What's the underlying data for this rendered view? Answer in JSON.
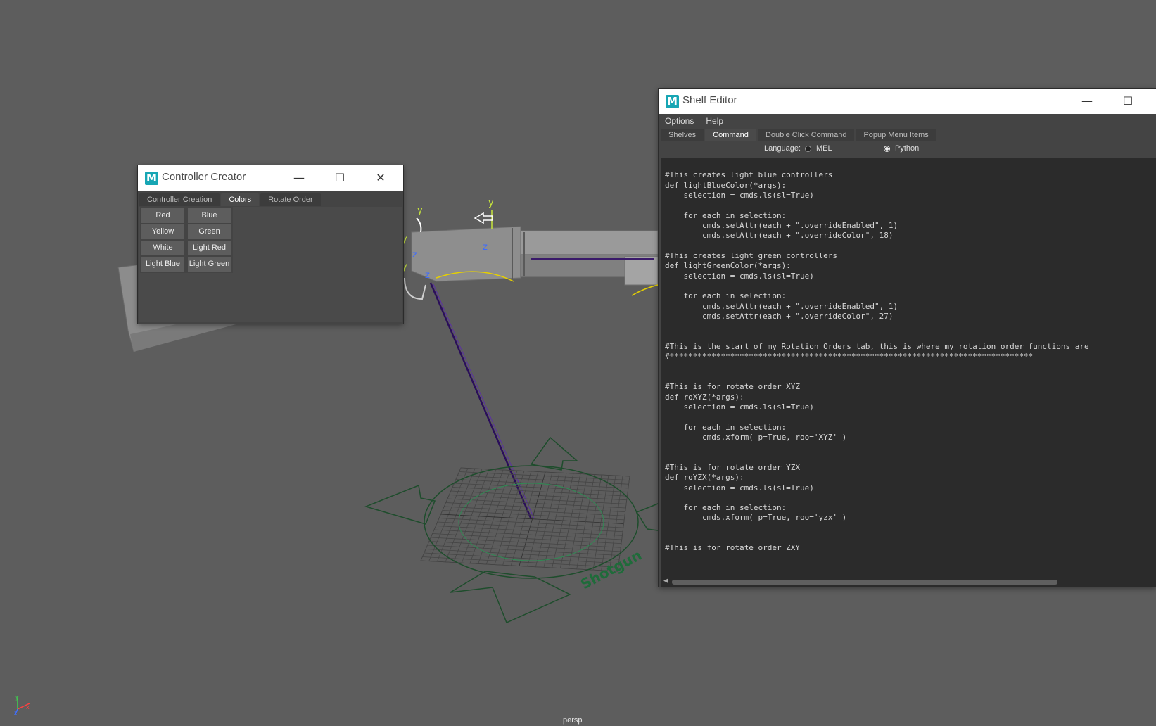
{
  "viewport": {
    "camera_label": "persp",
    "controller_text": "Shotgun",
    "axis_labels": {
      "y": "y",
      "z": "z",
      "x": "x"
    }
  },
  "controller_creator": {
    "title": "Controller Creator",
    "window_buttons": {
      "minimize": "—",
      "maximize": "☐",
      "close": "✕"
    },
    "tabs": [
      {
        "label": "Controller Creation",
        "active": false
      },
      {
        "label": "Colors",
        "active": true
      },
      {
        "label": "Rotate Order",
        "active": false
      }
    ],
    "color_buttons": [
      "Red",
      "Blue",
      "Yellow",
      "Green",
      "White",
      "Light Red",
      "Light Blue",
      "Light Green"
    ]
  },
  "shelf_editor": {
    "title": "Shelf Editor",
    "window_buttons": {
      "minimize": "—",
      "maximize": "☐"
    },
    "menu": [
      "Options",
      "Help"
    ],
    "tabs": [
      {
        "label": "Shelves",
        "active": false
      },
      {
        "label": "Command",
        "active": true
      },
      {
        "label": "Double Click Command",
        "active": false
      },
      {
        "label": "Popup Menu Items",
        "active": false
      }
    ],
    "language_label": "Language:",
    "languages": [
      {
        "label": "MEL",
        "selected": false
      },
      {
        "label": "Python",
        "selected": true
      }
    ],
    "code_lines": [
      "",
      "#This creates light blue controllers",
      "def lightBlueColor(*args):",
      "    selection = cmds.ls(sl=True)",
      "",
      "    for each in selection:",
      "        cmds.setAttr(each + \".overrideEnabled\", 1)",
      "        cmds.setAttr(each + \".overrideColor\", 18)",
      "",
      "#This creates light green controllers",
      "def lightGreenColor(*args):",
      "    selection = cmds.ls(sl=True)",
      "",
      "    for each in selection:",
      "        cmds.setAttr(each + \".overrideEnabled\", 1)",
      "        cmds.setAttr(each + \".overrideColor\", 27)",
      "",
      "",
      "#This is the start of my Rotation Orders tab, this is where my rotation order functions are",
      "#******************************************************************************",
      "",
      "",
      "#This is for rotate order XYZ",
      "def roXYZ(*args):",
      "    selection = cmds.ls(sl=True)",
      "",
      "    for each in selection:",
      "        cmds.xform( p=True, roo='XYZ' )",
      "",
      "",
      "#This is for rotate order YZX",
      "def roYZX(*args):",
      "    selection = cmds.ls(sl=True)",
      "",
      "    for each in selection:",
      "        cmds.xform( p=True, roo='yzx' )",
      "",
      "",
      "#This is for rotate order ZXY"
    ]
  }
}
